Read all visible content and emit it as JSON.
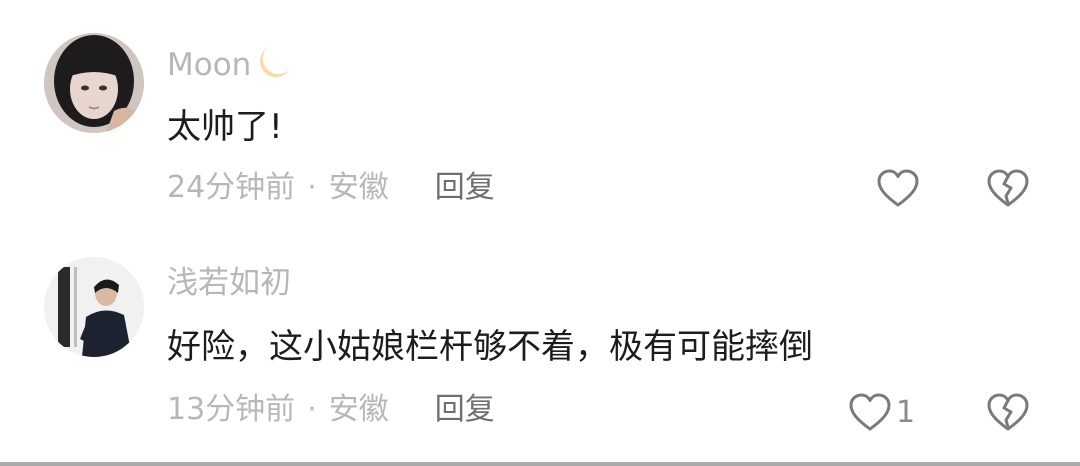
{
  "comments": [
    {
      "username": "Moon",
      "badge_icon": "crescent-moon-icon",
      "text": "太帅了!",
      "time": "24分钟前",
      "separator": "·",
      "location": "安徽",
      "reply_label": "回复",
      "like_icon": "heart-outline-icon",
      "like_count": "",
      "dislike_icon": "broken-heart-icon"
    },
    {
      "username": "浅若如初",
      "text": "好险，这小姑娘栏杆够不着，极有可能摔倒",
      "time": "13分钟前",
      "separator": "·",
      "location": "安徽",
      "reply_label": "回复",
      "like_icon": "heart-outline-icon",
      "like_count": "1",
      "dislike_icon": "broken-heart-icon"
    }
  ],
  "colors": {
    "username": "#b7b7b7",
    "text": "#1c1c1c",
    "meta": "#b7b7b7",
    "reply": "#6f6f6f",
    "icon": "#7a7a7a",
    "moon": "#f7dcaa"
  }
}
